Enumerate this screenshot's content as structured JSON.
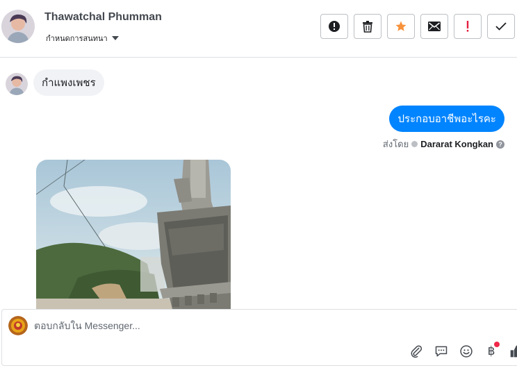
{
  "header": {
    "contact_name": "Thawatchal Phumman",
    "conversation_options_label": "กำหนดการสนทนา",
    "actions": [
      {
        "name": "mark-spam-button",
        "icon": "alert-circle-icon"
      },
      {
        "name": "delete-button",
        "icon": "trash-icon"
      },
      {
        "name": "star-button",
        "icon": "star-icon"
      },
      {
        "name": "mark-unread-button",
        "icon": "envelope-icon"
      },
      {
        "name": "follow-up-button",
        "icon": "exclamation-icon"
      },
      {
        "name": "mark-done-button",
        "icon": "checkmark-icon"
      }
    ]
  },
  "thread": {
    "incoming_message": "กำแพงเพชร",
    "outgoing_message": "ประกอบอาชีพอะไรคะ",
    "sent_by_label": "ส่งโดย",
    "sent_by_agent": "Dararat Kongkan",
    "help_glyph": "?"
  },
  "composer": {
    "placeholder": "ตอบกลับใน Messenger...",
    "value": "",
    "tools": [
      "paperclip-icon",
      "chat-bubble-icon",
      "smile-icon",
      "baht-icon",
      "thumbs-up-icon"
    ],
    "baht_glyph": "฿"
  },
  "colors": {
    "accent": "#0084ff",
    "incoming_bubble": "#f0f2f5",
    "star": "#f7923b",
    "alert_red": "#e41e3f",
    "notification_dot": "#f02849"
  }
}
